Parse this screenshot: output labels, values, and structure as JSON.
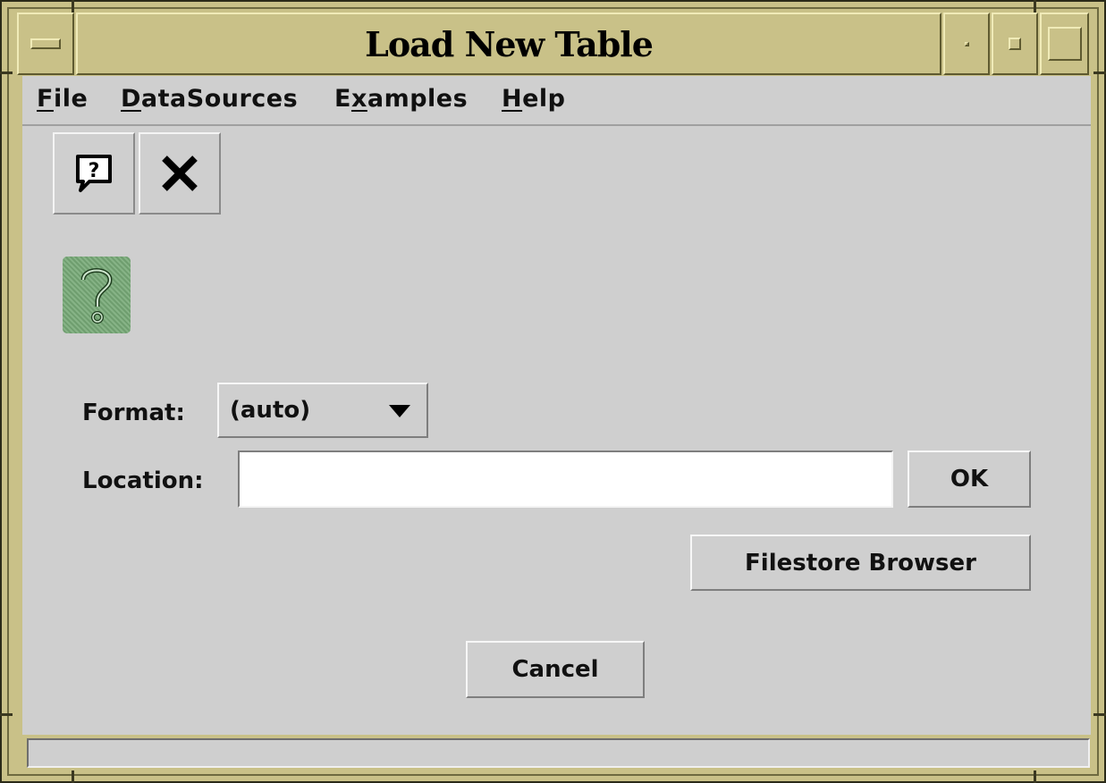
{
  "window": {
    "title": "Load New Table",
    "menu_button_icon": "window-menu-icon",
    "minimize_icon": "minimize-icon",
    "maximize_icon": "maximize-icon",
    "close_icon": "square-icon"
  },
  "menubar": {
    "items": [
      {
        "label": "File",
        "mnemonic": "F",
        "rest": "ile"
      },
      {
        "label": "DataSources",
        "mnemonic": "D",
        "rest": "ataSources"
      },
      {
        "label": "Examples",
        "pre": "E",
        "mnemonic": "x",
        "rest": "amples"
      },
      {
        "label": "Help",
        "mnemonic": "H",
        "rest": "elp"
      }
    ]
  },
  "toolbar": {
    "help_icon": "help-bubble-icon",
    "close_icon": "close-x-icon"
  },
  "status_icon": "question-mark-icon",
  "form": {
    "format_label": "Format:",
    "format_value": "(auto)",
    "location_label": "Location:",
    "location_value": "",
    "ok_label": "OK",
    "filestore_label": "Filestore Browser",
    "cancel_label": "Cancel"
  },
  "colors": {
    "frame": "#c9c188",
    "panel": "#cfcfcf",
    "help_icon_bg": "#7fae7f"
  }
}
